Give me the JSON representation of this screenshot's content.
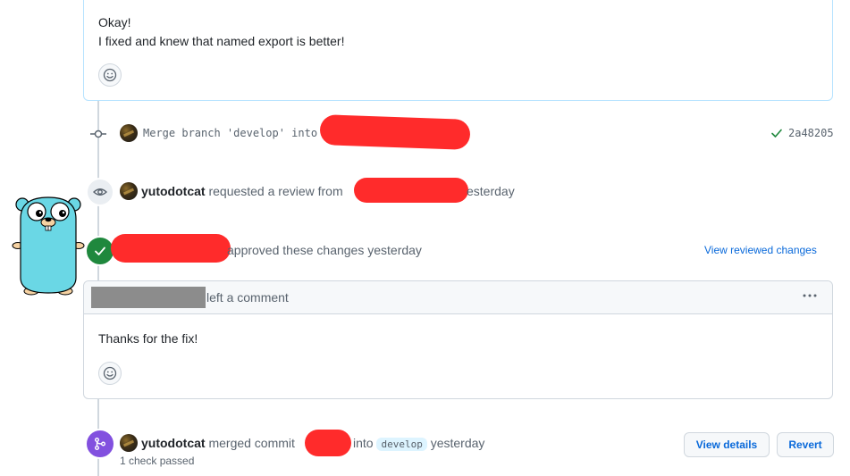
{
  "top_comment": {
    "line1": "Okay!",
    "line2": "I fixed and knew that named export is better!"
  },
  "commit_event": {
    "message": "Merge branch 'develop' into",
    "status_icon": "check-icon",
    "sha": "2a48205"
  },
  "review_request_event": {
    "user": "yutodotcat",
    "text": "requested a review from",
    "suffix": "esterday"
  },
  "approval_event": {
    "text": "approved these changes yesterday",
    "link": "View reviewed changes"
  },
  "review_comment": {
    "header": "left a comment",
    "body": "Thanks for the fix!",
    "menu_icon": "kebab-horizontal-icon"
  },
  "merge_event": {
    "user": "yutodotcat",
    "text": "merged commit",
    "into": "into",
    "branch": "develop",
    "when": "yesterday",
    "checks": "1 check passed",
    "view_details_label": "View details",
    "revert_label": "Revert"
  },
  "colors": {
    "approved_green": "#1f883d",
    "merged_purple": "#8250df",
    "link_blue": "#0969da",
    "redaction_red": "#ff2b2b",
    "gopher_blue": "#6ad7e5"
  }
}
